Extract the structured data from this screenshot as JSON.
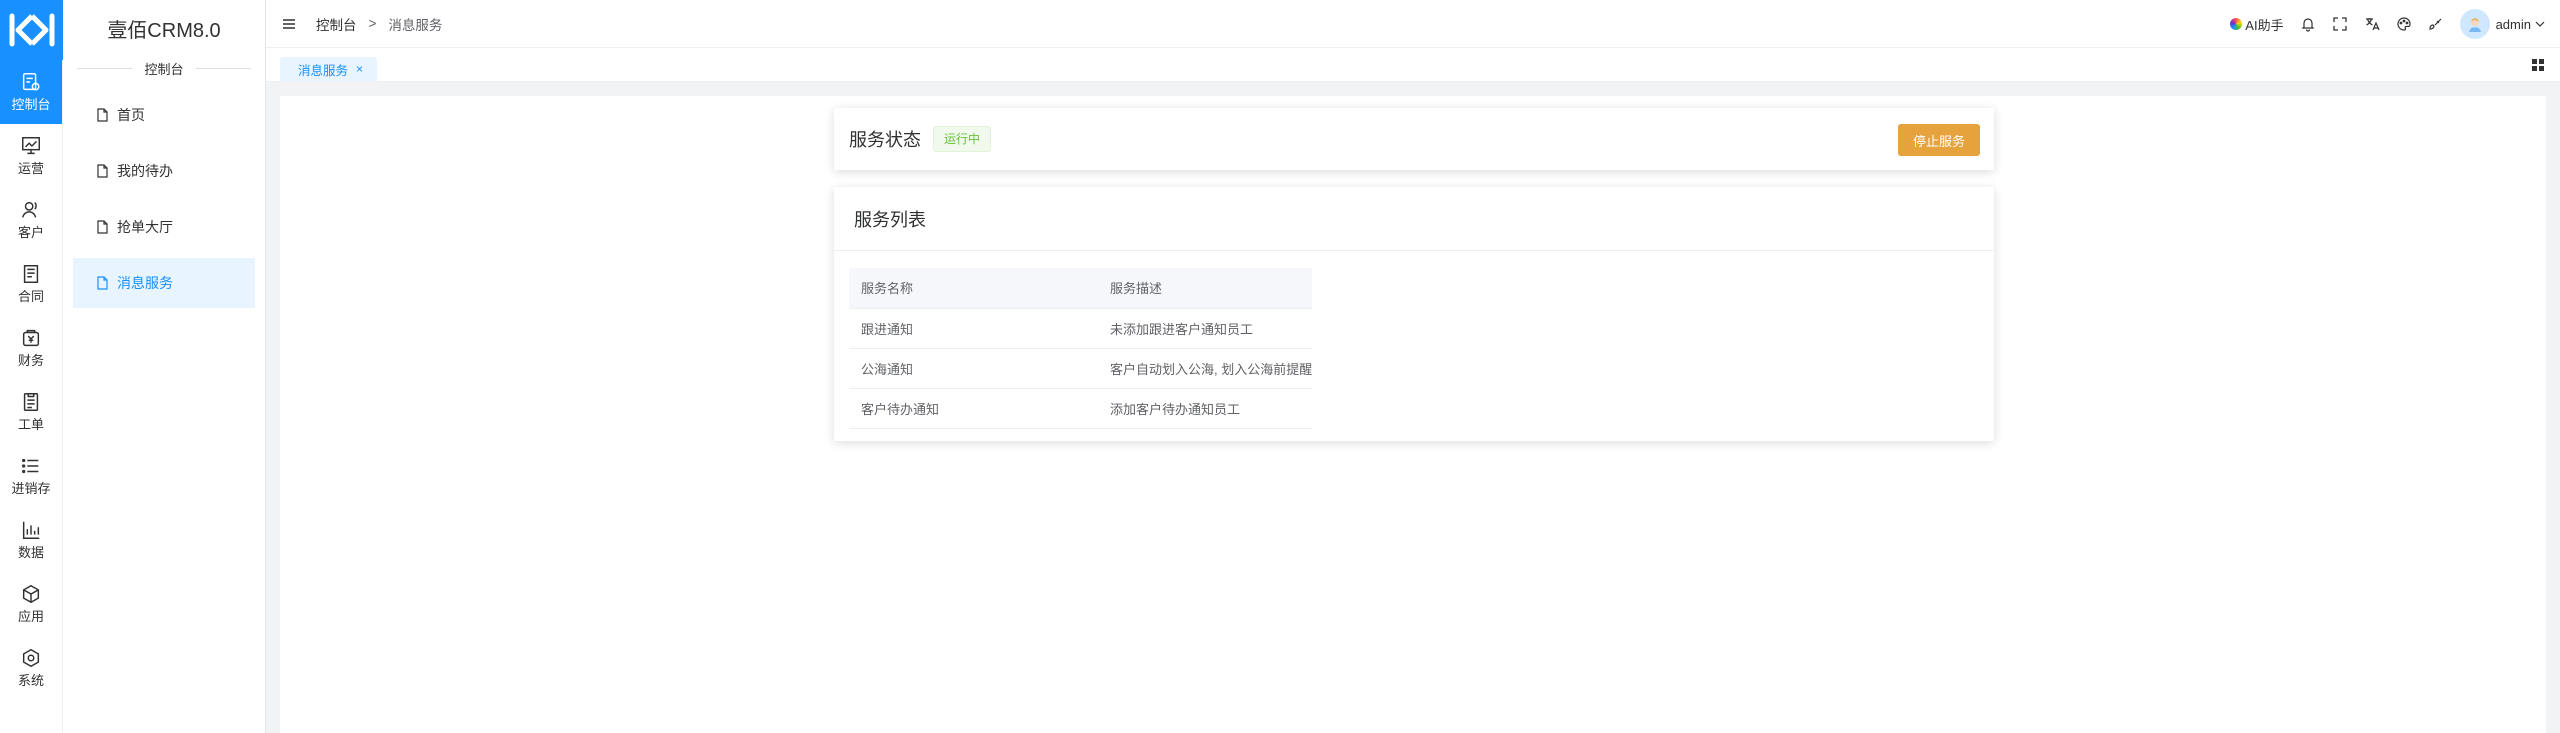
{
  "app": {
    "brand": "壹佰CRM8.0",
    "section_title": "控制台"
  },
  "colors": {
    "primary": "#1890ff",
    "warning": "#e6a23c",
    "success": "#67c23a"
  },
  "rail": [
    {
      "label": "控制台",
      "icon": "dashboard-icon",
      "active": true
    },
    {
      "label": "运营",
      "icon": "chart-icon",
      "active": false
    },
    {
      "label": "客户",
      "icon": "user-icon",
      "active": false
    },
    {
      "label": "合同",
      "icon": "contract-icon",
      "active": false
    },
    {
      "label": "财务",
      "icon": "finance-icon",
      "active": false
    },
    {
      "label": "工单",
      "icon": "ticket-icon",
      "active": false
    },
    {
      "label": "进销存",
      "icon": "list-icon",
      "active": false
    },
    {
      "label": "数据",
      "icon": "bar-chart-icon",
      "active": false
    },
    {
      "label": "应用",
      "icon": "cube-icon",
      "active": false
    },
    {
      "label": "系统",
      "icon": "hexagon-icon",
      "active": false
    }
  ],
  "sidebar": {
    "items": [
      {
        "label": "首页",
        "active": false
      },
      {
        "label": "我的待办",
        "active": false
      },
      {
        "label": "抢单大厅",
        "active": false
      },
      {
        "label": "消息服务",
        "active": true
      }
    ]
  },
  "header": {
    "breadcrumb": [
      "控制台",
      "消息服务"
    ],
    "breadcrumb_sep": ">",
    "ai_label": "AI助手",
    "user_name": "admin"
  },
  "tabs": [
    {
      "label": "消息服务",
      "close": "×"
    }
  ],
  "status_card": {
    "title": "服务状态",
    "badge": "运行中",
    "stop_button": "停止服务"
  },
  "list_card": {
    "title": "服务列表",
    "columns": [
      "服务名称",
      "服务描述"
    ],
    "rows": [
      [
        "跟进通知",
        "未添加跟进客户通知员工"
      ],
      [
        "公海通知",
        "客户自动划入公海, 划入公海前提醒"
      ],
      [
        "客户待办通知",
        "添加客户待办通知员工"
      ]
    ]
  }
}
